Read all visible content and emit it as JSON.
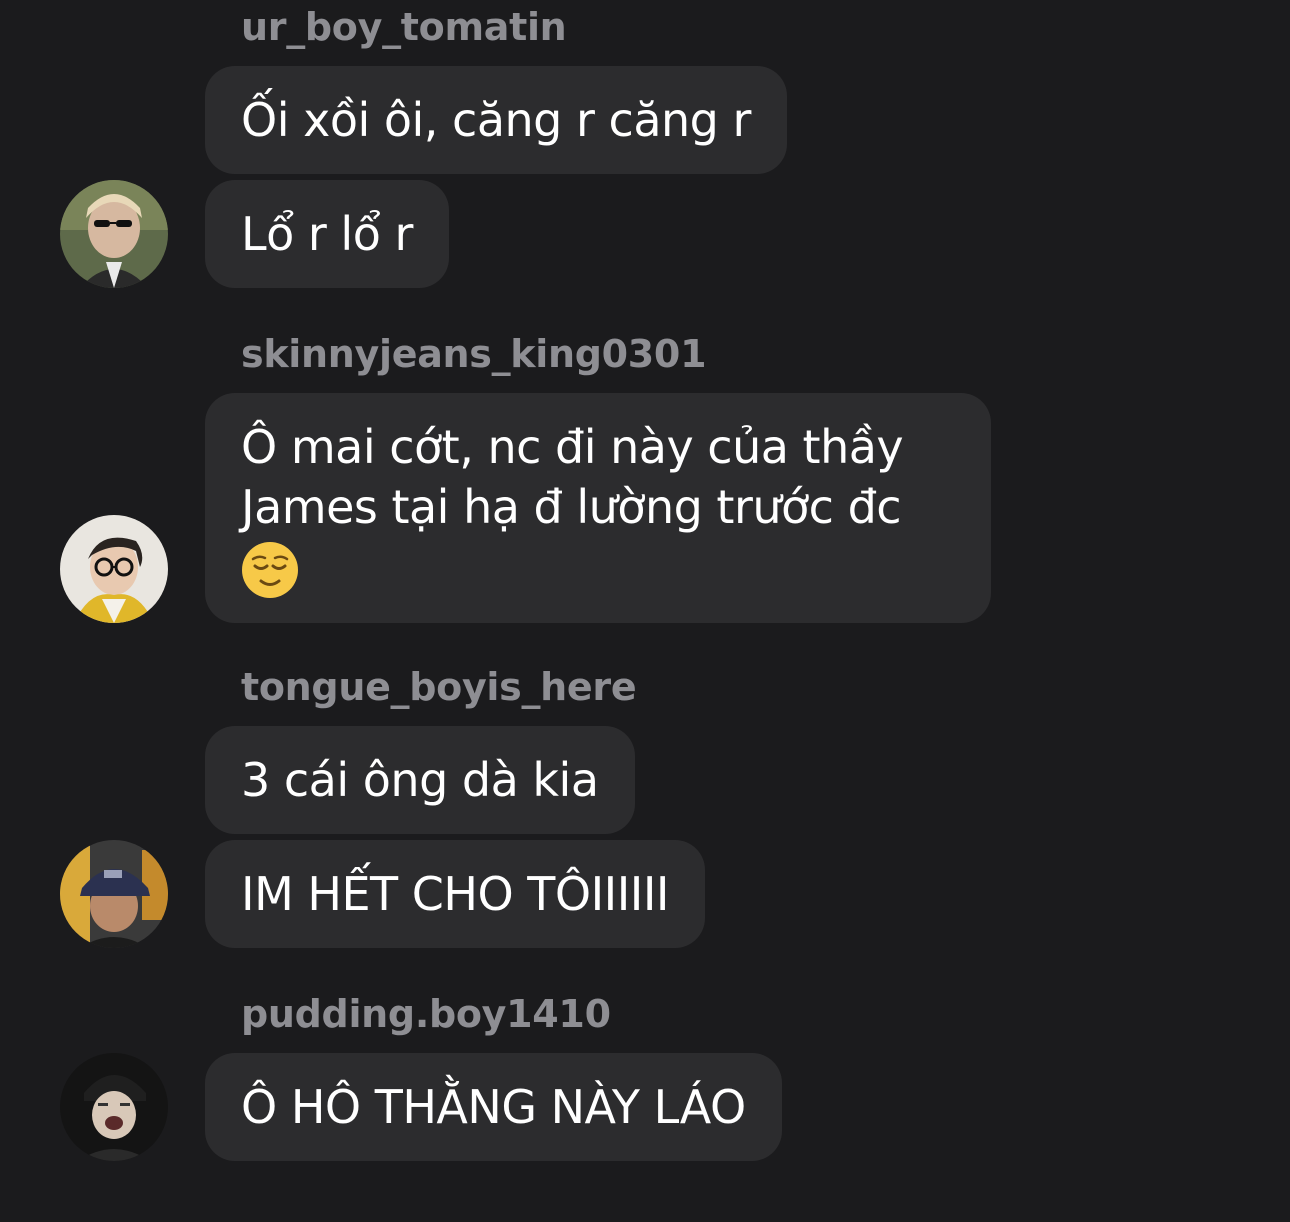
{
  "messages": [
    {
      "sender": "ur_boy_tomatin",
      "avatar_icon": "profile-photo-sunglasses",
      "bubbles": [
        "Ối xồi ôi, căng r căng r",
        "Lổ r lổ r"
      ]
    },
    {
      "sender": "skinnyjeans_king0301",
      "avatar_icon": "profile-photo-glasses",
      "bubbles": [
        "Ô mai cớt, nc đi này của thầy James tại hạ đ lường trước đc"
      ],
      "emoji": "relieved-face-emoji"
    },
    {
      "sender": "tongue_boyis_here",
      "avatar_icon": "profile-photo-cap",
      "bubbles": [
        "3 cái ông dà kia",
        "IM HẾT CHO TÔIIIIII"
      ]
    },
    {
      "sender": "pudding.boy1410",
      "avatar_icon": "profile-photo-dark",
      "bubbles": [
        "Ô HÔ THẰNG NÀY LÁO"
      ]
    }
  ],
  "colors": {
    "background": "#1b1b1d",
    "bubble": "#2c2c2e",
    "sender_text": "#8e8e93",
    "message_text": "#ffffff",
    "emoji": "#f7c948"
  }
}
